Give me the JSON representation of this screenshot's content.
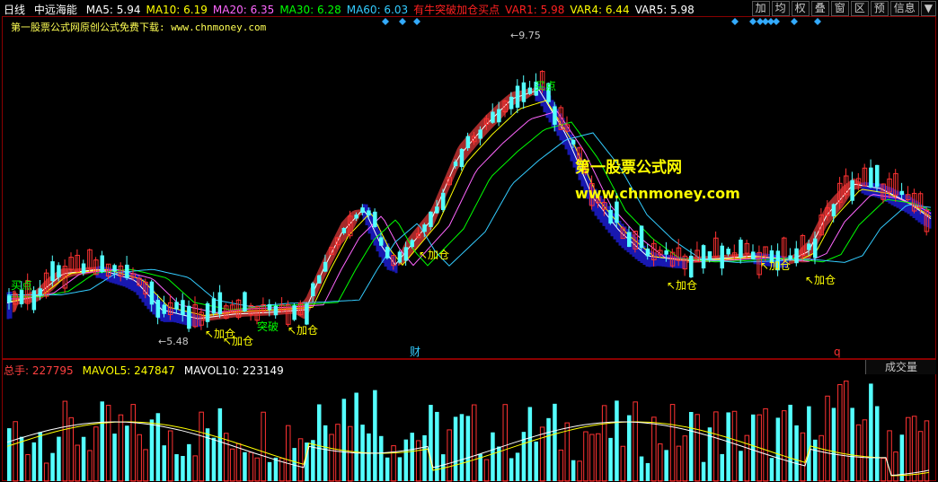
{
  "window": {
    "period": "日线",
    "stock_name": "中远海能"
  },
  "ma_legend": [
    {
      "label": "MA5:",
      "value": "5.94",
      "color": "#ffffff"
    },
    {
      "label": "MA10:",
      "value": "6.19",
      "color": "#ffff00"
    },
    {
      "label": "MA20:",
      "value": "6.35",
      "color": "#ff66ff"
    },
    {
      "label": "MA30:",
      "value": "6.28",
      "color": "#00ff00"
    },
    {
      "label": "MA60:",
      "value": "6.03",
      "color": "#33ccff"
    },
    {
      "label": "有牛突破加仓买点",
      "value": "",
      "color": "#ff2020"
    },
    {
      "label": "VAR1:",
      "value": "5.98",
      "color": "#ff2020"
    },
    {
      "label": "VAR4:",
      "value": "6.44",
      "color": "#ffff00"
    },
    {
      "label": "VAR5:",
      "value": "5.98",
      "color": "#ffffff"
    }
  ],
  "toolbar": [
    "加",
    "均",
    "权",
    "叠",
    "窗",
    "区",
    "预",
    "信息",
    "▼"
  ],
  "formula_note": "第一股票公式网原创公式免费下载: www.chnmoney.com",
  "watermark": {
    "line1": "第一股票公式网",
    "line2": "www.chnmoney.com"
  },
  "annotations": {
    "high_price": "9.75",
    "low_price": "5.48",
    "buy_label": "买点",
    "add_label": "加仓",
    "break_label": "突破",
    "fin_marker": "财",
    "q_marker": "q"
  },
  "volume_legend": [
    {
      "label": "总手:",
      "value": "227795",
      "color": "#ff4040"
    },
    {
      "label": "MAVOL5:",
      "value": "247847",
      "color": "#ffff00"
    },
    {
      "label": "MAVOL10:",
      "value": "223149",
      "color": "#ffffff"
    }
  ],
  "volume_tab": "成交量",
  "colors": {
    "up": "#ff3232",
    "down": "#54ffff",
    "band_up": "#a52a2a",
    "band_down": "#1e1edc",
    "frame": "#8a0000"
  }
}
